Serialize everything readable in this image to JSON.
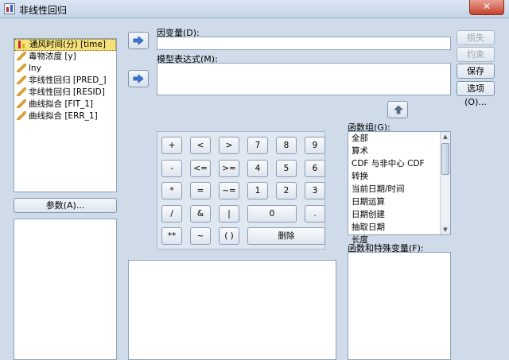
{
  "window": {
    "title": "非线性回归",
    "close_glyph": "✕"
  },
  "variables": [
    {
      "label": "通风时间(分) [time]",
      "icon": "scale-bars-icon",
      "selected": true
    },
    {
      "label": "毒物浓度 [y]",
      "icon": "ruler-icon"
    },
    {
      "label": "lny",
      "icon": "ruler-icon"
    },
    {
      "label": "非线性回归 [PRED_]",
      "icon": "ruler-icon"
    },
    {
      "label": "非线性回归 [RESID]",
      "icon": "ruler-icon"
    },
    {
      "label": "曲线拟合 [FIT_1]",
      "icon": "ruler-icon"
    },
    {
      "label": "曲线拟合 [ERR_1]",
      "icon": "ruler-icon"
    }
  ],
  "params_button": "参数(A)...",
  "dependent_label": "因变量(D):",
  "model_label": "模型表达式(M):",
  "side_buttons": [
    {
      "label": "损失(L)...",
      "enabled": false
    },
    {
      "label": "约束(C)...",
      "enabled": false
    },
    {
      "label": "保存(S)...",
      "enabled": true
    },
    {
      "label": "选项(O)...",
      "enabled": true
    }
  ],
  "calculator": {
    "rows": [
      [
        "+",
        "<",
        ">",
        "7",
        "8",
        "9"
      ],
      [
        "-",
        "<=",
        ">=",
        "4",
        "5",
        "6"
      ],
      [
        "*",
        "=",
        "~=",
        "1",
        "2",
        "3"
      ],
      [
        "/",
        "&",
        "|",
        "0",
        "."
      ],
      [
        "**",
        "~",
        "( )",
        "删除"
      ]
    ]
  },
  "func_group_label": "函数组(G):",
  "func_groups": [
    "全部",
    "算术",
    "CDF 与非中心 CDF",
    "转换",
    "当前日期/时间",
    "日期运算",
    "日期创建",
    "抽取日期",
    "长度"
  ],
  "func_special_label": "函数和特殊变量(F):",
  "colors": {
    "background": "#cfdbe9",
    "selection": "#f7e27a",
    "arrow": "#3a78d8"
  }
}
